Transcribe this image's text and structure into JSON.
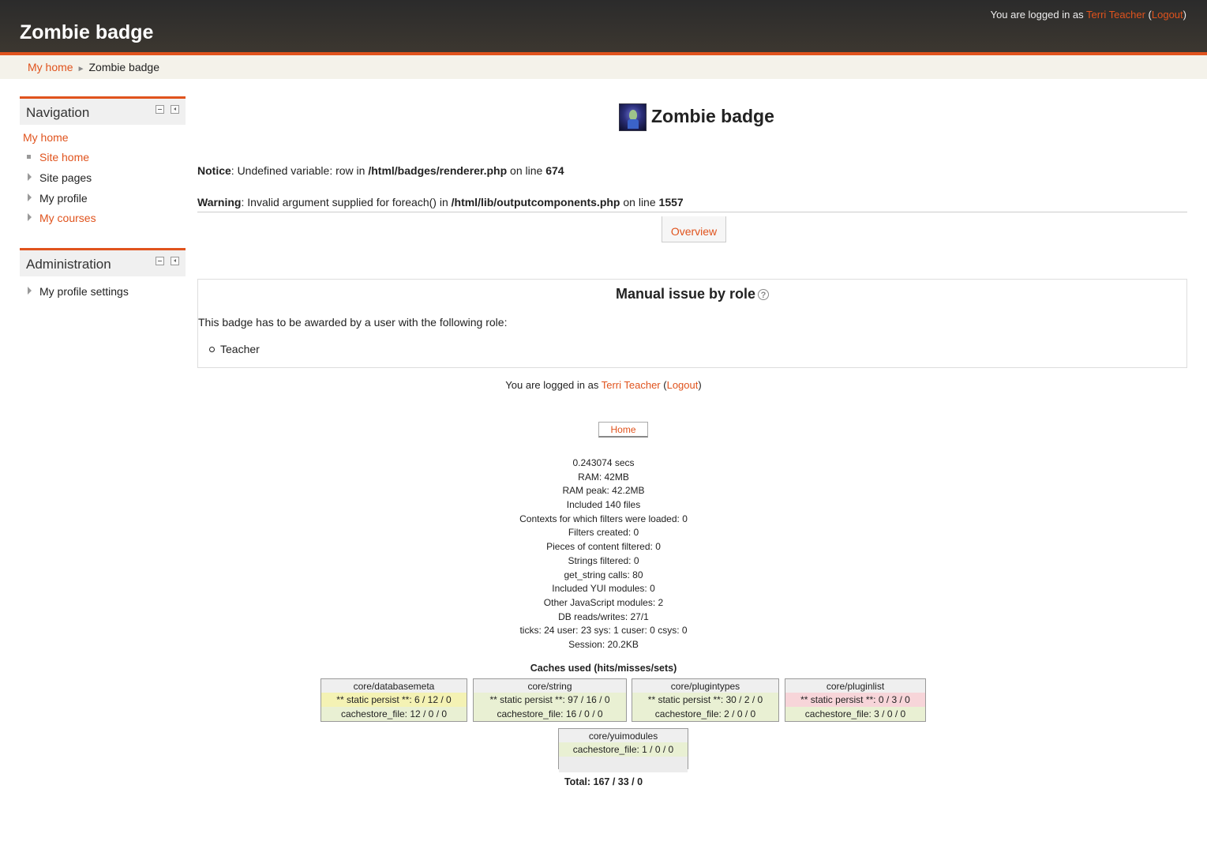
{
  "header": {
    "site_title": "Zombie badge",
    "login_prefix": "You are logged in as ",
    "user_name": "Terri Teacher",
    "logout": "Logout"
  },
  "breadcrumb": {
    "items": [
      "My home",
      "Zombie badge"
    ],
    "separator": "►"
  },
  "navigation_block": {
    "title": "Navigation",
    "my_home": "My home",
    "items": [
      {
        "label": "Site home",
        "marker": "square"
      },
      {
        "label": "Site pages",
        "marker": "triangle"
      },
      {
        "label": "My profile",
        "marker": "triangle"
      },
      {
        "label": "My courses",
        "marker": "triangle"
      }
    ]
  },
  "administration_block": {
    "title": "Administration",
    "items": [
      {
        "label": "My profile settings",
        "marker": "triangle"
      }
    ]
  },
  "badge": {
    "title": "Zombie badge",
    "image_icon": "zombie-badge-image"
  },
  "errors": {
    "notice": {
      "label": "Notice",
      "text1": ": Undefined variable: row in ",
      "file": "/html/badges/renderer.php",
      "text2": " on line ",
      "line": "674"
    },
    "warning": {
      "label": "Warning",
      "text1": ": Invalid argument supplied for foreach() in ",
      "file": "/html/lib/outputcomponents.php",
      "text2": " on line ",
      "line": "1557"
    }
  },
  "tabs": {
    "overview": "Overview"
  },
  "criteria": {
    "title": "Manual issue by role",
    "help_icon": "help-icon",
    "help_glyph": "?",
    "description": "This badge has to be awarded by a user with the following role:",
    "roles": [
      "Teacher"
    ]
  },
  "footer": {
    "login_prefix": "You are logged in as ",
    "user_name": "Terri Teacher",
    "logout": "Logout",
    "home_button": "Home"
  },
  "performance": [
    "0.243074 secs",
    "RAM: 42MB",
    "RAM peak: 42.2MB",
    "Included 140 files",
    "Contexts for which filters were loaded: 0",
    "Filters created: 0",
    "Pieces of content filtered: 0",
    "Strings filtered: 0",
    "get_string calls: 80",
    "Included YUI modules: 0",
    "Other JavaScript modules: 2",
    "DB reads/writes: 27/1",
    "ticks: 24 user: 23 sys: 1 cuser: 0 csys: 0",
    "Session: 20.2KB"
  ],
  "caches": {
    "title": "Caches used (hits/misses/sets)",
    "items": [
      {
        "name": "core/databasemeta",
        "rows": [
          {
            "text": "** static persist **: 6 / 12 / 0",
            "status": "yellow"
          },
          {
            "text": "cachestore_file: 12 / 0 / 0",
            "status": "green"
          }
        ]
      },
      {
        "name": "core/string",
        "rows": [
          {
            "text": "** static persist **: 97 / 16 / 0",
            "status": "green"
          },
          {
            "text": "cachestore_file: 16 / 0 / 0",
            "status": "green"
          }
        ]
      },
      {
        "name": "core/plugintypes",
        "rows": [
          {
            "text": "** static persist **: 30 / 2 / 0",
            "status": "green"
          },
          {
            "text": "cachestore_file: 2 / 0 / 0",
            "status": "green"
          }
        ]
      },
      {
        "name": "core/pluginlist",
        "rows": [
          {
            "text": "** static persist **: 0 / 3 / 0",
            "status": "red"
          },
          {
            "text": "cachestore_file: 3 / 0 / 0",
            "status": "green"
          }
        ]
      },
      {
        "name": "core/yuimodules",
        "rows": [
          {
            "text": "cachestore_file: 1 / 0 / 0",
            "status": "green"
          }
        ]
      }
    ],
    "total": "Total: 167 / 33 / 0"
  },
  "colors": {
    "accent": "#e0531d",
    "header_bg": "#2f2c28",
    "cache_green": "#e9f0d3",
    "cache_yellow": "#f4f2b4",
    "cache_red": "#f7d5d9"
  }
}
